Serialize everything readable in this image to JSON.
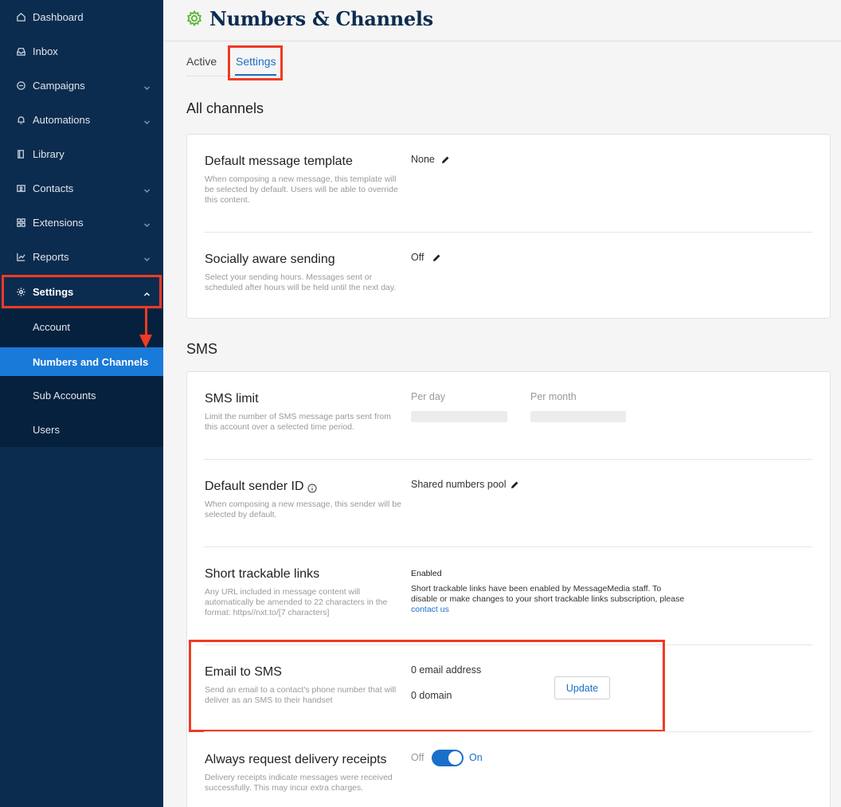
{
  "sidebar": {
    "items": [
      {
        "label": "Dashboard",
        "icon": "home-icon"
      },
      {
        "label": "Inbox",
        "icon": "inbox-icon"
      },
      {
        "label": "Campaigns",
        "icon": "chat-icon"
      },
      {
        "label": "Automations",
        "icon": "bell-icon"
      },
      {
        "label": "Library",
        "icon": "book-icon"
      },
      {
        "label": "Contacts",
        "icon": "contact-card-icon"
      },
      {
        "label": "Extensions",
        "icon": "grid-icon"
      },
      {
        "label": "Reports",
        "icon": "line-chart-icon"
      },
      {
        "label": "Settings",
        "icon": "gear-icon"
      }
    ],
    "subitems": [
      {
        "label": "Account"
      },
      {
        "label": "Numbers and Channels"
      },
      {
        "label": "Sub Accounts"
      },
      {
        "label": "Users"
      }
    ]
  },
  "header": {
    "title": "Numbers & Channels"
  },
  "tabs": [
    {
      "label": "Active"
    },
    {
      "label": "Settings"
    }
  ],
  "sections": {
    "all_channels": {
      "title": "All channels",
      "default_template": {
        "title": "Default message template",
        "desc": "When composing a new message, this template will be selected by default. Users will be able to override this content.",
        "value": "None"
      },
      "socially_aware": {
        "title": "Socially aware sending",
        "desc": "Select your sending hours. Messages sent or scheduled after hours will be held until the next day.",
        "value": "Off"
      }
    },
    "sms": {
      "title": "SMS",
      "limit": {
        "title": "SMS limit",
        "desc": "Limit the number of SMS message parts sent from this account over a selected time period.",
        "per_day": "Per day",
        "per_month": "Per month"
      },
      "sender": {
        "title": "Default sender ID",
        "desc": "When composing a new message, this sender will be selected by default.",
        "value": "Shared numbers pool"
      },
      "links": {
        "title": "Short trackable links",
        "desc": "Any URL included in message content will automatically be amended to 22 characters in the format: https//nxt.to/[7 characters]",
        "status": "Enabled",
        "note": "Short trackable links have been enabled by MessageMedia staff. To disable or make changes to your short trackable links subscription, please",
        "link": "contact us"
      },
      "email_to_sms": {
        "title": "Email to SMS",
        "desc": "Send an email to a contact's phone number that will deliver as an SMS to their handset",
        "email_count": "0 email address",
        "domain_count": "0 domain",
        "button": "Update"
      },
      "receipts": {
        "title": "Always request delivery receipts",
        "desc": "Delivery receipts indicate messages were received successfully. This may incur extra charges.",
        "off_label": "Off",
        "on_label": "On"
      }
    }
  },
  "colors": {
    "sidebar": "#0c2c4f",
    "accent": "#1a7ad9",
    "highlight": "#ef3b24",
    "gear": "#5cb337"
  }
}
